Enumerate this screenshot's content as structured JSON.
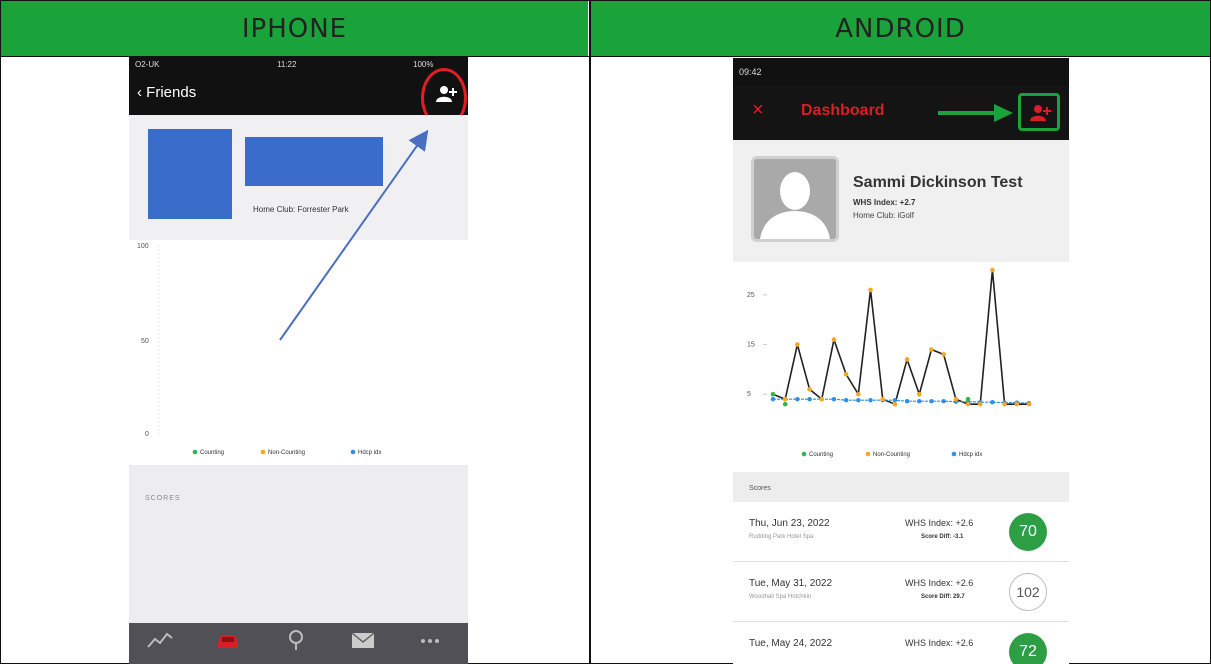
{
  "table": {
    "headers": [
      "IPHONE",
      "ANDROID"
    ],
    "colors": {
      "header_bg": "#1aa33a",
      "border": "#111111"
    }
  },
  "iphone": {
    "status": {
      "carrier": "O2-UK",
      "time": "11:22",
      "battery": "100%"
    },
    "nav": {
      "back_label": "Friends",
      "action_icon": "add-user-icon"
    },
    "profile": {
      "home_club": "Home Club: Forrester Park"
    },
    "chart_data": {
      "type": "line",
      "ylim": [
        0,
        100
      ],
      "yticks": [
        "100",
        "50",
        "0"
      ],
      "legend": [
        "Counting",
        "Non-Counting",
        "Hdcp idx"
      ],
      "legend_colors": [
        "#2eb84a",
        "#f5a623",
        "#2f8fe8"
      ],
      "series": []
    },
    "scores_label": "SCORES",
    "tabs": [
      {
        "icon": "trend-icon",
        "label": ""
      },
      {
        "icon": "car-icon",
        "label": "",
        "active": true
      },
      {
        "icon": "pin-icon",
        "label": ""
      },
      {
        "icon": "mail-icon",
        "label": ""
      },
      {
        "icon": "more-icon",
        "label": ""
      }
    ],
    "annotation_color": "#e21e24"
  },
  "android": {
    "status": {
      "time": "09:42"
    },
    "toolbar": {
      "close": "×",
      "title": "Dashboard",
      "action_icon": "add-user-icon"
    },
    "annotation_color": "#1aa33a",
    "profile": {
      "name": "Sammi Dickinson Test",
      "whs": "WHS Index: +2.7",
      "club": "Home Club: iGolf"
    },
    "chart_data": {
      "type": "line",
      "ylim": [
        -3,
        30
      ],
      "yticks": [
        "25",
        "15",
        "5"
      ],
      "ytick_values": [
        25,
        15,
        5
      ],
      "legend": [
        "Counting",
        "Non-Counting",
        "Hdcp idx"
      ],
      "legend_colors": [
        "#2eb84a",
        "#f5a623",
        "#2f8fe8"
      ],
      "x": [
        1,
        2,
        3,
        4,
        5,
        6,
        7,
        8,
        9,
        10,
        11,
        12,
        13,
        14,
        15,
        16,
        17,
        18,
        19,
        20,
        21,
        22
      ],
      "series": [
        {
          "name": "Counting",
          "values": [
            5,
            3,
            null,
            null,
            null,
            null,
            null,
            null,
            null,
            null,
            null,
            null,
            null,
            null,
            null,
            null,
            4,
            null,
            null,
            null,
            null,
            null
          ]
        },
        {
          "name": "Non-Counting",
          "values": [
            5,
            4,
            15,
            6,
            4,
            16,
            9,
            5,
            26,
            4,
            3,
            12,
            5,
            14,
            13,
            4,
            3,
            3,
            30,
            3,
            3,
            3
          ]
        },
        {
          "name": "Hdcp idx",
          "values": [
            4,
            4,
            4,
            4,
            4,
            4,
            3.8,
            3.8,
            3.8,
            3.8,
            3.8,
            3.6,
            3.6,
            3.6,
            3.6,
            3.5,
            3.5,
            3.4,
            3.4,
            3.3,
            3.3,
            3.2
          ]
        }
      ]
    },
    "scores_label": "Scores",
    "scores": [
      {
        "date": "Thu, Jun 23, 2022",
        "course": "Rudding Park Hotel Spa",
        "whs": "WHS Index: +2.6",
        "diff": "Score Diff: -3.1",
        "score": "70",
        "style": "green"
      },
      {
        "date": "Tue, May 31, 2022",
        "course": "Woodhall Spa Hotchkin",
        "whs": "WHS Index: +2.6",
        "diff": "Score Diff: 29.7",
        "score": "102",
        "style": "outline"
      },
      {
        "date": "Tue, May 24, 2022",
        "course": "",
        "whs": "WHS Index: +2.6",
        "diff": "",
        "score": "72",
        "style": "green"
      }
    ]
  }
}
